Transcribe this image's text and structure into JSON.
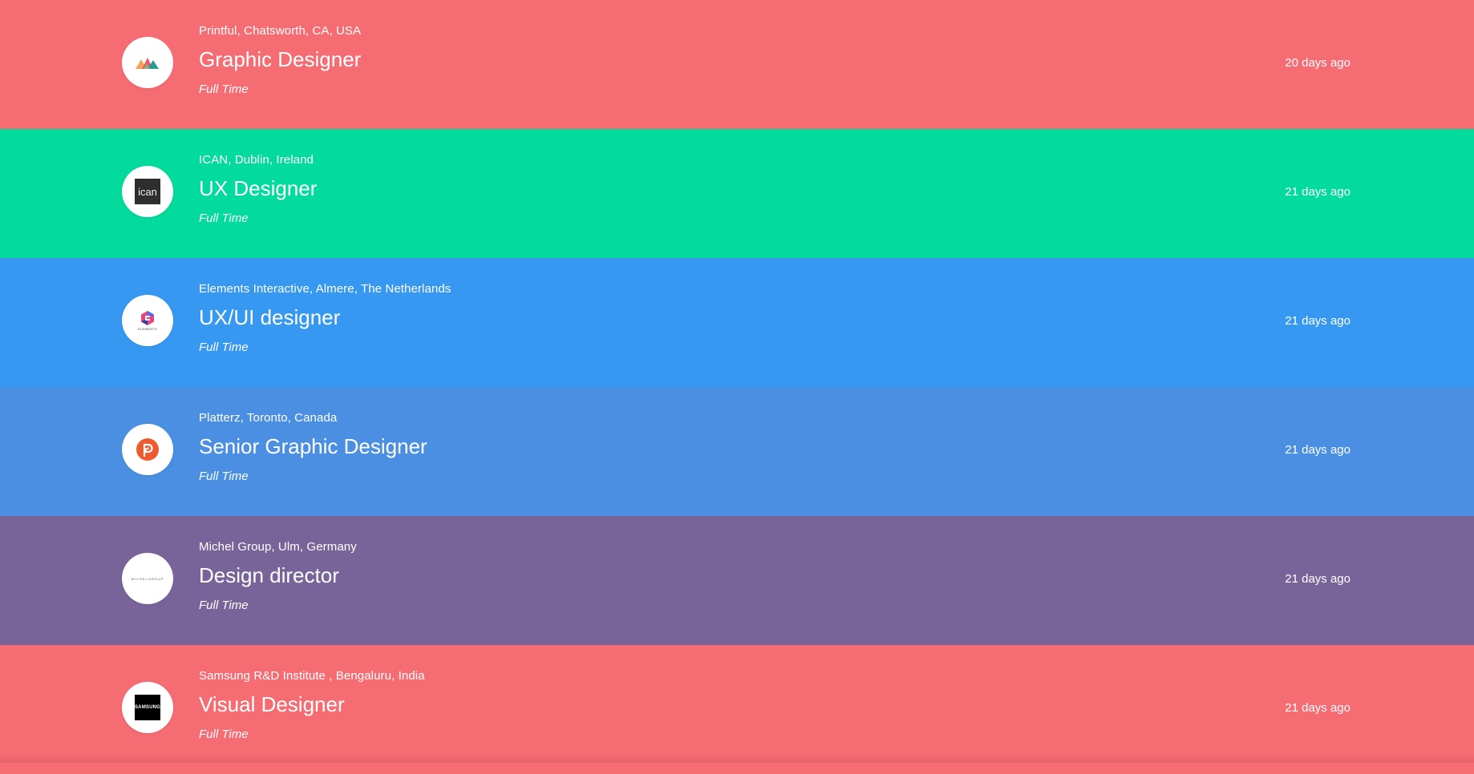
{
  "jobs": [
    {
      "company": "Printful, Chatsworth, CA, USA",
      "title": "Graphic Designer",
      "type": "Full Time",
      "age": "20 days ago",
      "color": "#f66c73",
      "logo": "printful-logo"
    },
    {
      "company": "ICAN, Dublin, Ireland",
      "title": "UX Designer",
      "type": "Full Time",
      "age": "21 days ago",
      "color": "#03db9c",
      "logo": "ican-logo",
      "logo_text": "ican"
    },
    {
      "company": "Elements Interactive, Almere, The Netherlands",
      "title": "UX/UI designer",
      "type": "Full Time",
      "age": "21 days ago",
      "color": "#3698f1",
      "logo": "elements-logo",
      "logo_text": "ELEMENTS"
    },
    {
      "company": "Platterz, Toronto, Canada",
      "title": "Senior Graphic Designer",
      "type": "Full Time",
      "age": "21 days ago",
      "color": "#4a8fe2",
      "logo": "platterz-logo"
    },
    {
      "company": "Michel Group, Ulm, Germany",
      "title": "Design director",
      "type": "Full Time",
      "age": "21 days ago",
      "color": "#786499",
      "logo": "michelgroup-logo",
      "logo_text": "MICHELGROUP"
    },
    {
      "company": "Samsung R&D Institute , Bengaluru, India",
      "title": "Visual Designer",
      "type": "Full Time",
      "age": "21 days ago",
      "color": "#f66c73",
      "logo": "samsung-logo",
      "logo_text": "SAMSUNG"
    }
  ]
}
